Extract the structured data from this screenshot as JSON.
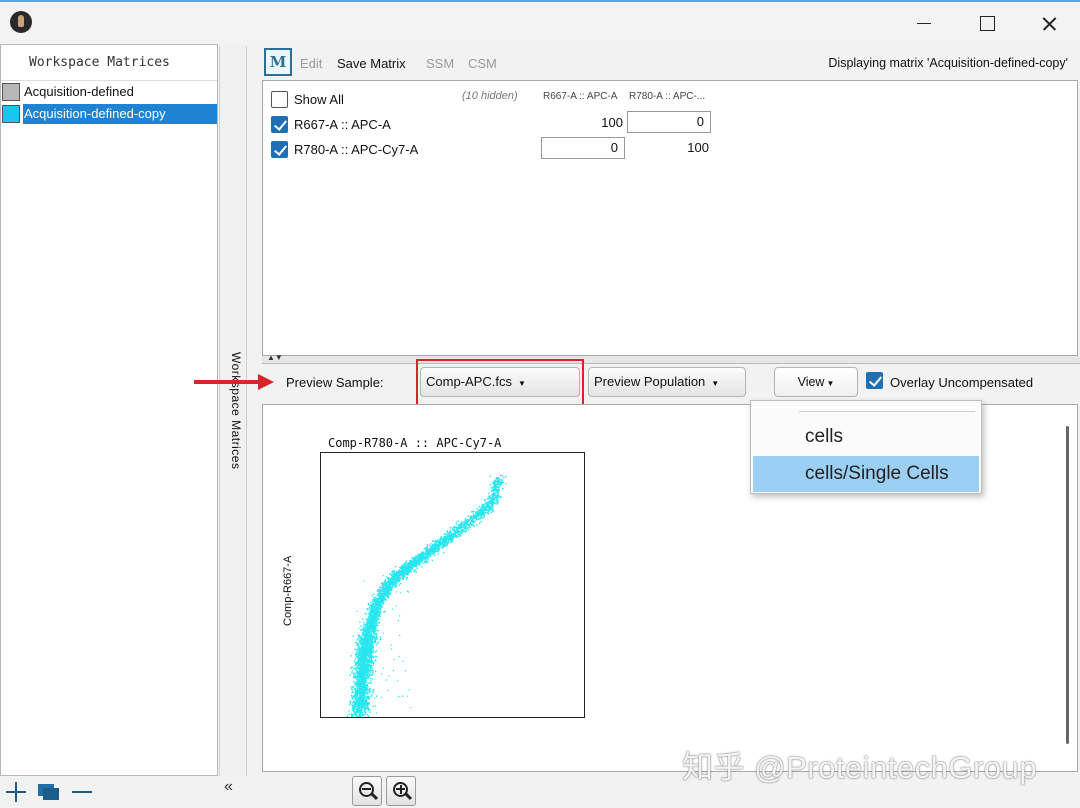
{
  "sidebar": {
    "title": "Workspace Matrices",
    "items": [
      {
        "label": "Acquisition-defined",
        "color": "#b8b8b8"
      },
      {
        "label": "Acquisition-defined-copy",
        "color": "#19c6f2"
      }
    ],
    "collapse_glyph": "«",
    "vertical_tab_label": "Workspace Matrices"
  },
  "toolbar": {
    "logo": "M",
    "edit": "Edit",
    "save_matrix": "Save Matrix",
    "ssm": "SSM",
    "csm": "CSM",
    "display_text": "Displaying matrix 'Acquisition-defined-copy'"
  },
  "matrix": {
    "show_all": "Show All",
    "hidden_note": "(10 hidden)",
    "columns": [
      "R667-A :: APC-A",
      "R780-A :: APC-..."
    ],
    "rows": [
      {
        "label": "R667-A :: APC-A",
        "values": [
          "100",
          "0"
        ],
        "checked": true
      },
      {
        "label": "R780-A :: APC-Cy7-A",
        "values": [
          "0",
          "100"
        ],
        "checked": true
      }
    ]
  },
  "preview": {
    "sample_label": "Preview Sample:",
    "sample_value": "Comp-APC.fcs",
    "population_label": "Preview Population",
    "view_label": "View",
    "overlay_label": "Overlay Uncompensated",
    "overlay_checked": true
  },
  "plot": {
    "title": "Comp-R780-A :: APC-Cy7-A",
    "ylabel": "Comp-R667-A",
    "point_color": "#29e6ee"
  },
  "menu": {
    "items": [
      "cells",
      "cells/Single Cells"
    ],
    "selected_index": 1
  },
  "watermark": "知乎 @ProteintechGroup",
  "colors": {
    "selection": "#1e83d2",
    "highlight_box": "#d6262c",
    "menu_selected": "#9ccff4"
  }
}
